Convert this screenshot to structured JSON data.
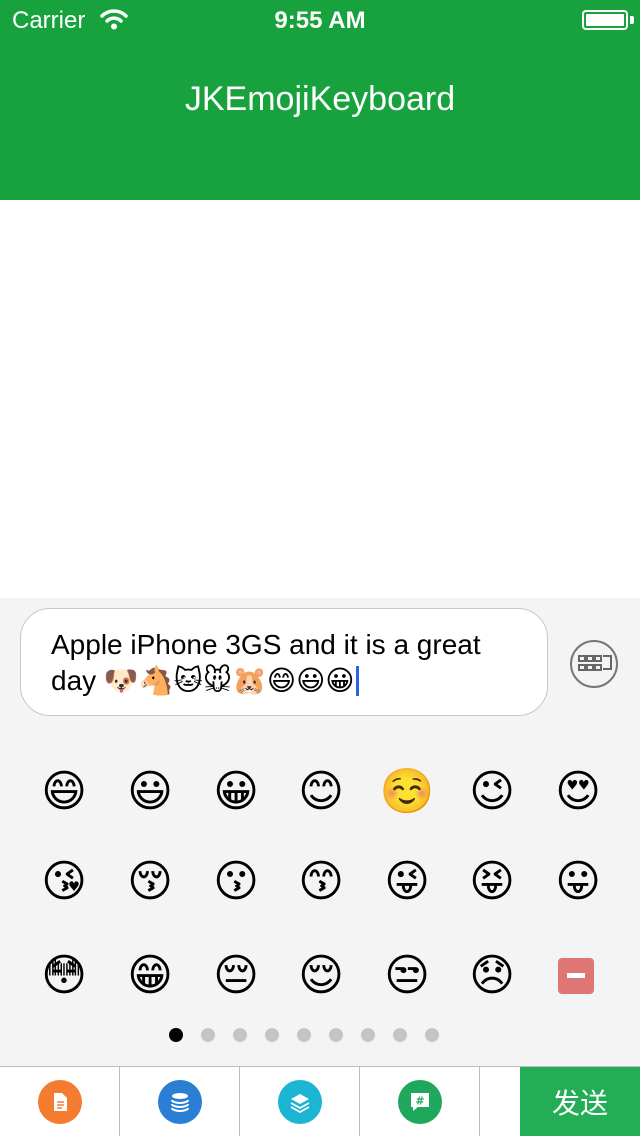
{
  "status_bar": {
    "carrier": "Carrier",
    "time": "9:55 AM"
  },
  "nav": {
    "title": "JKEmojiKeyboard"
  },
  "input": {
    "text": "Apple iPhone 3GS and it is a great day 🐶🐴🐱🐭🐹😄😃😀",
    "keyboard_toggle_icon": "keyboard-icon"
  },
  "emoji_grid": {
    "rows": [
      [
        "😄",
        "😃",
        "😀",
        "😊",
        "☺️",
        "😉",
        "😍"
      ],
      [
        "😘",
        "😚",
        "😗",
        "😙",
        "😜",
        "😝",
        "😛"
      ],
      [
        "😳",
        "😁",
        "😔",
        "😌",
        "😒",
        "😞"
      ]
    ],
    "delete_icon": "delete-icon",
    "page_count": 9,
    "current_page": 1
  },
  "toolbar": {
    "items": [
      {
        "icon": "document-icon",
        "color": "#f37c31"
      },
      {
        "icon": "coins-stack-icon",
        "color": "#2a7fd4"
      },
      {
        "icon": "layers-icon",
        "color": "#1cb5d4"
      },
      {
        "icon": "hashtag-chat-icon",
        "color": "#1fa85b"
      }
    ],
    "send_label": "发送"
  },
  "colors": {
    "header": "#17a23d",
    "send_button": "#23ad57",
    "caret": "#2b63e6",
    "delete_key": "#e07575"
  }
}
